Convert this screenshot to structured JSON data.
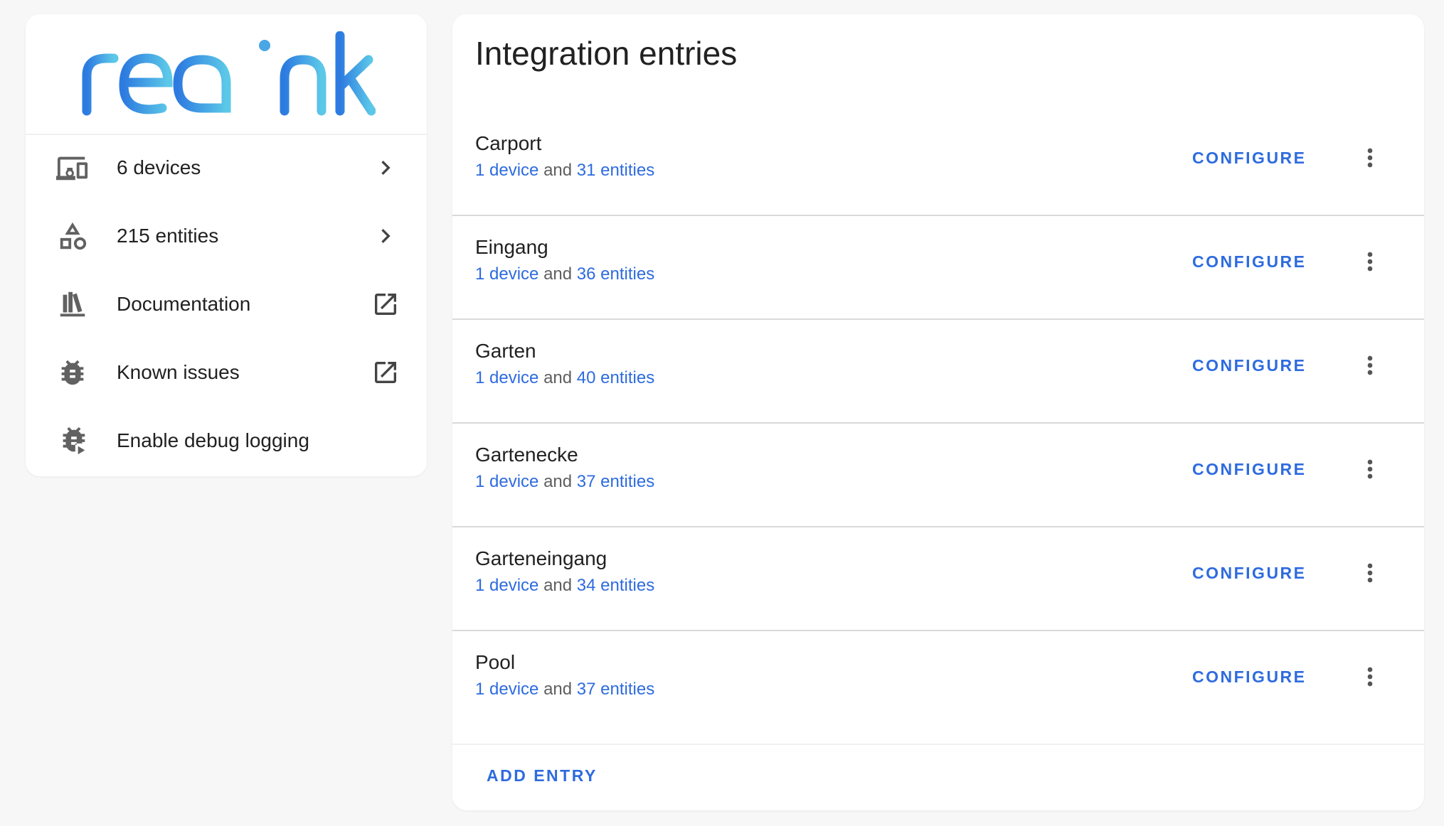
{
  "brand": {
    "logo_text": "reolink",
    "colors": {
      "gradient_start": "#2d7be0",
      "gradient_end": "#5cc8e8"
    }
  },
  "sidebar": {
    "items": [
      {
        "icon": "devices-icon",
        "label": "6 devices",
        "trailing": "chevron-right-icon"
      },
      {
        "icon": "shapes-icon",
        "label": "215 entities",
        "trailing": "chevron-right-icon"
      },
      {
        "icon": "bookshelf-icon",
        "label": "Documentation",
        "trailing": "open-in-new-icon"
      },
      {
        "icon": "bug-icon",
        "label": "Known issues",
        "trailing": "open-in-new-icon"
      },
      {
        "icon": "bug-play-icon",
        "label": "Enable debug logging",
        "trailing": ""
      }
    ]
  },
  "main": {
    "title": "Integration entries",
    "entries": [
      {
        "name": "Carport",
        "device_text": "1 device",
        "and_text": "and",
        "entity_text": "31 entities",
        "configure": "CONFIGURE"
      },
      {
        "name": "Eingang",
        "device_text": "1 device",
        "and_text": "and",
        "entity_text": "36 entities",
        "configure": "CONFIGURE"
      },
      {
        "name": "Garten",
        "device_text": "1 device",
        "and_text": "and",
        "entity_text": "40 entities",
        "configure": "CONFIGURE"
      },
      {
        "name": "Gartenecke",
        "device_text": "1 device",
        "and_text": "and",
        "entity_text": "37 entities",
        "configure": "CONFIGURE"
      },
      {
        "name": "Garteneingang",
        "device_text": "1 device",
        "and_text": "and",
        "entity_text": "34 entities",
        "configure": "CONFIGURE"
      },
      {
        "name": "Pool",
        "device_text": "1 device",
        "and_text": "and",
        "entity_text": "37 entities",
        "configure": "CONFIGURE"
      }
    ],
    "add_entry": "ADD ENTRY"
  },
  "colors": {
    "accent": "#2e6bdf",
    "icon": "#616161",
    "divider": "#d9d9d9"
  }
}
